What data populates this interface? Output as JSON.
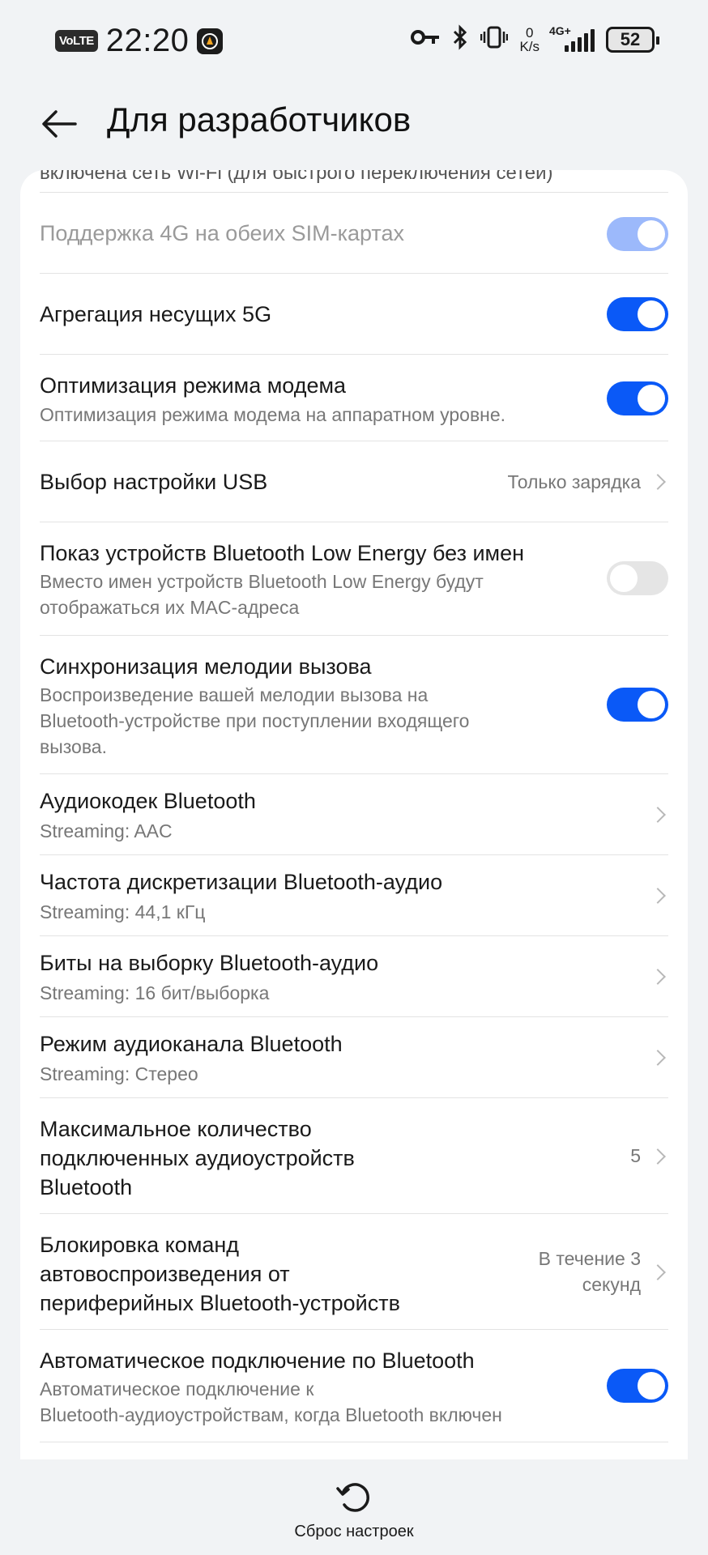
{
  "status_bar": {
    "volte": "VoLTE",
    "time": "22:20",
    "net_speed_value": "0",
    "net_speed_unit": "K/s",
    "network_type": "4G+",
    "battery": "52"
  },
  "header": {
    "title": "Для разработчиков"
  },
  "settings": {
    "truncated_text": "включена сеть Wi-Fi (для быстрого переключения сетей)",
    "items": [
      {
        "title": "Поддержка 4G на обеих SIM-картах",
        "toggle": "on-disabled"
      },
      {
        "title": "Агрегация несущих 5G",
        "toggle": "on"
      },
      {
        "title": "Оптимизация режима модема",
        "subtitle": "Оптимизация режима модема на аппаратном уровне.",
        "toggle": "on"
      },
      {
        "title": "Выбор настройки USB",
        "value": "Только зарядка"
      },
      {
        "title": "Показ устройств Bluetooth Low Energy без имен",
        "subtitle_1": "Вместо имен устройств Bluetooth Low Energy будут",
        "subtitle_2": "отображаться их MAC-адреса",
        "toggle": "off"
      },
      {
        "title": "Синхронизация мелодии вызова",
        "subtitle_1": "Воспроизведение вашей мелодии вызова на",
        "subtitle_2": "Bluetooth-устройстве при поступлении входящего",
        "subtitle_3": "вызова.",
        "toggle": "on"
      },
      {
        "title": "Аудиокодек Bluetooth",
        "subtitle": "Streaming: AAC"
      },
      {
        "title": "Частота дискретизации Bluetooth-аудио",
        "subtitle": "Streaming: 44,1 кГц"
      },
      {
        "title": "Биты на выборку Bluetooth-аудио",
        "subtitle": "Streaming: 16 бит/выборка"
      },
      {
        "title": "Режим аудиоканала Bluetooth",
        "subtitle": "Streaming: Стерео"
      },
      {
        "title_1": "Максимальное количество",
        "title_2": "подключенных аудиоустройств",
        "title_3": "Bluetooth",
        "value": "5"
      },
      {
        "title_1": "Блокировка команд",
        "title_2": "автовоспроизведения от",
        "title_3": "периферийных Bluetooth-устройств",
        "value_1": "В течение 3",
        "value_2": "секунд"
      },
      {
        "title": "Автоматическое подключение по Bluetooth",
        "subtitle_1": "Автоматическое подключение к",
        "subtitle_2": "Bluetooth-аудиоустройствам, когда Bluetooth включен",
        "toggle": "on"
      }
    ]
  },
  "footer": {
    "reset_label": "Сброс настроек"
  },
  "colors": {
    "accent": "#0a59f7",
    "background": "#f1f3f5"
  }
}
